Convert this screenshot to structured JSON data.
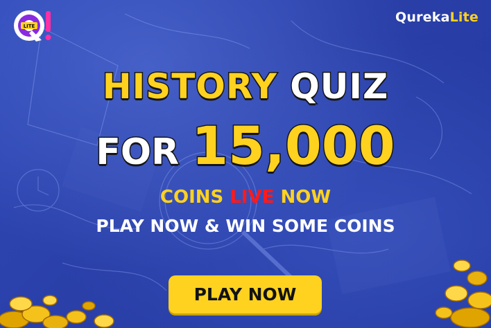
{
  "brand": {
    "main": "Qureka",
    "accent": "Lite"
  },
  "logo": {
    "letter": "Q",
    "badge": "LITE"
  },
  "headline": {
    "line1_a": "HISTORY",
    "line1_b": "QUIZ",
    "line2_a": "FOR",
    "line2_b": "15,000"
  },
  "subline": {
    "coins": "COINS",
    "live": "LIVE",
    "now": "NOW",
    "tagline": "PLAY NOW & WIN SOME COINS"
  },
  "cta": {
    "label": "PLAY NOW"
  },
  "colors": {
    "background": "#2a3fa8",
    "accent_yellow": "#ffd21f",
    "live_red": "#ff1a1a",
    "logo_purple": "#8a2be2"
  },
  "icons": [
    "quiz-logo-icon",
    "coin-pile-icon"
  ]
}
